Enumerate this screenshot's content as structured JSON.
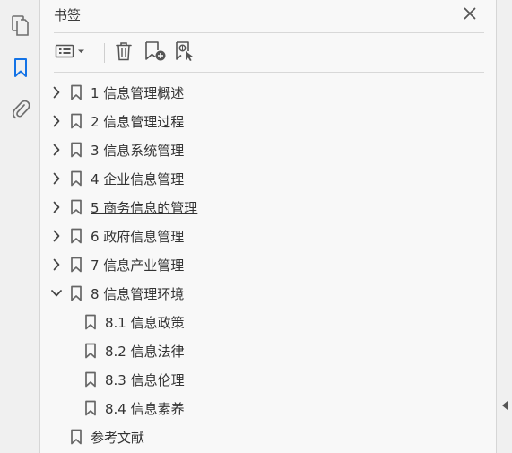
{
  "panel": {
    "title": "书签"
  },
  "rail": {
    "items": [
      {
        "name": "pages",
        "icon": "pages-icon",
        "active": false
      },
      {
        "name": "bookmarks",
        "icon": "bookmark-icon",
        "active": true
      },
      {
        "name": "attachments",
        "icon": "paperclip-icon",
        "active": false
      }
    ]
  },
  "toolbar": {
    "buttons": [
      {
        "icon": "options-menu-icon"
      },
      {
        "icon": "trash-icon"
      },
      {
        "icon": "add-bookmark-icon"
      },
      {
        "icon": "bookmark-search-icon"
      }
    ]
  },
  "bookmarks": [
    {
      "label": "1 信息管理概述",
      "level": 0,
      "expandable": true,
      "expanded": false
    },
    {
      "label": "2 信息管理过程",
      "level": 0,
      "expandable": true,
      "expanded": false
    },
    {
      "label": "3 信息系统管理",
      "level": 0,
      "expandable": true,
      "expanded": false
    },
    {
      "label": "4 企业信息管理",
      "level": 0,
      "expandable": true,
      "expanded": false
    },
    {
      "label": "5 商务信息的管理",
      "level": 0,
      "expandable": true,
      "expanded": false,
      "hover": true
    },
    {
      "label": "6 政府信息管理",
      "level": 0,
      "expandable": true,
      "expanded": false
    },
    {
      "label": "7 信息产业管理",
      "level": 0,
      "expandable": true,
      "expanded": false
    },
    {
      "label": "8 信息管理环境",
      "level": 0,
      "expandable": true,
      "expanded": true
    },
    {
      "label": "8.1 信息政策",
      "level": 1,
      "expandable": false
    },
    {
      "label": "8.2 信息法律",
      "level": 1,
      "expandable": false
    },
    {
      "label": "8.3 信息伦理",
      "level": 1,
      "expandable": false
    },
    {
      "label": "8.4 信息素养",
      "level": 1,
      "expandable": false
    },
    {
      "label": "参考文献",
      "level": 0,
      "expandable": false
    }
  ],
  "colors": {
    "accent": "#1473e6",
    "icon": "#6e6e6e"
  }
}
